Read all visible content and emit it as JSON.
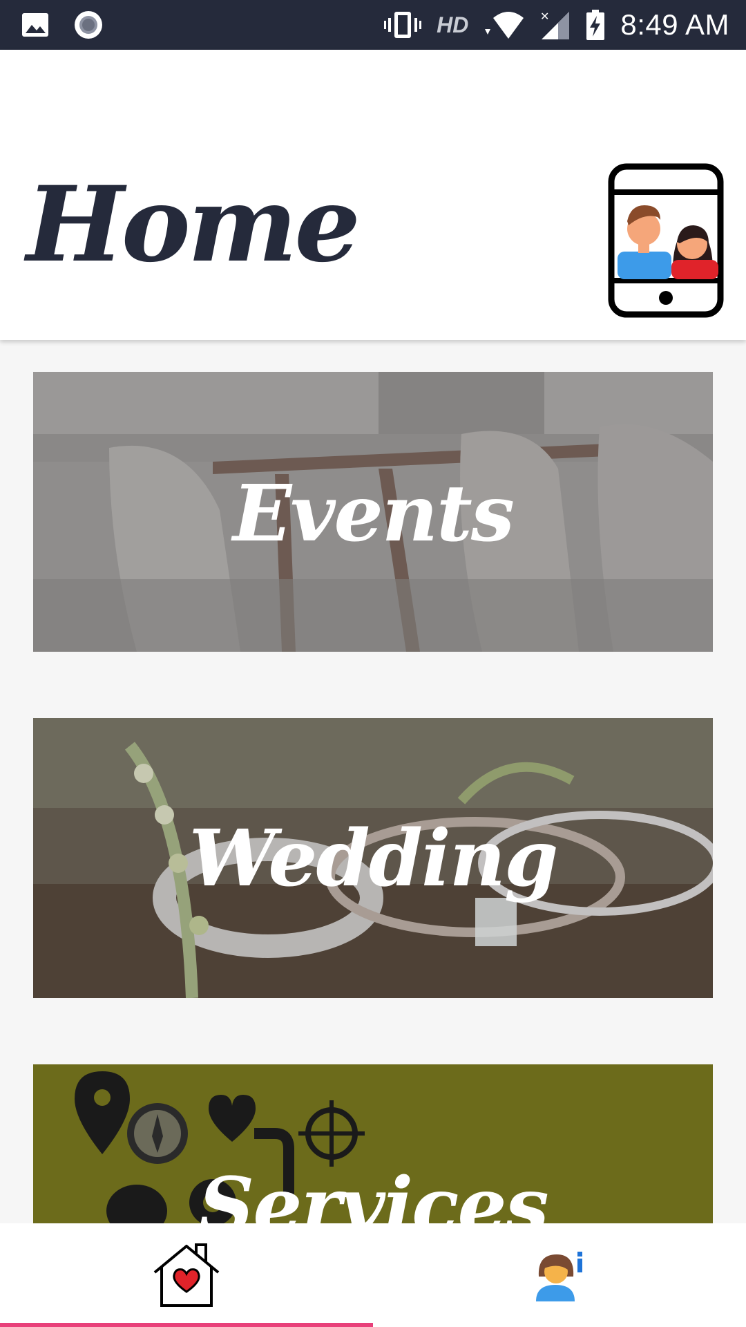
{
  "status_bar": {
    "time": "8:49 AM",
    "network_label": "HD",
    "icons": [
      "image-icon",
      "record-icon",
      "vibrate-icon",
      "wifi-icon",
      "signal-icon",
      "battery-charging-icon"
    ]
  },
  "header": {
    "title": "Home",
    "action_icon": "video-call-phone-icon"
  },
  "cards": [
    {
      "title": "Events"
    },
    {
      "title": "Wedding"
    },
    {
      "title": "Services"
    }
  ],
  "bottom_nav": {
    "items": [
      {
        "icon": "home-heart-icon",
        "selected": true
      },
      {
        "icon": "profile-info-icon",
        "selected": false
      }
    ],
    "accent_color": "#e8407a"
  },
  "colors": {
    "status_bar": "#252a3b",
    "title": "#252a3b",
    "services_card": "#6c6b1b"
  }
}
